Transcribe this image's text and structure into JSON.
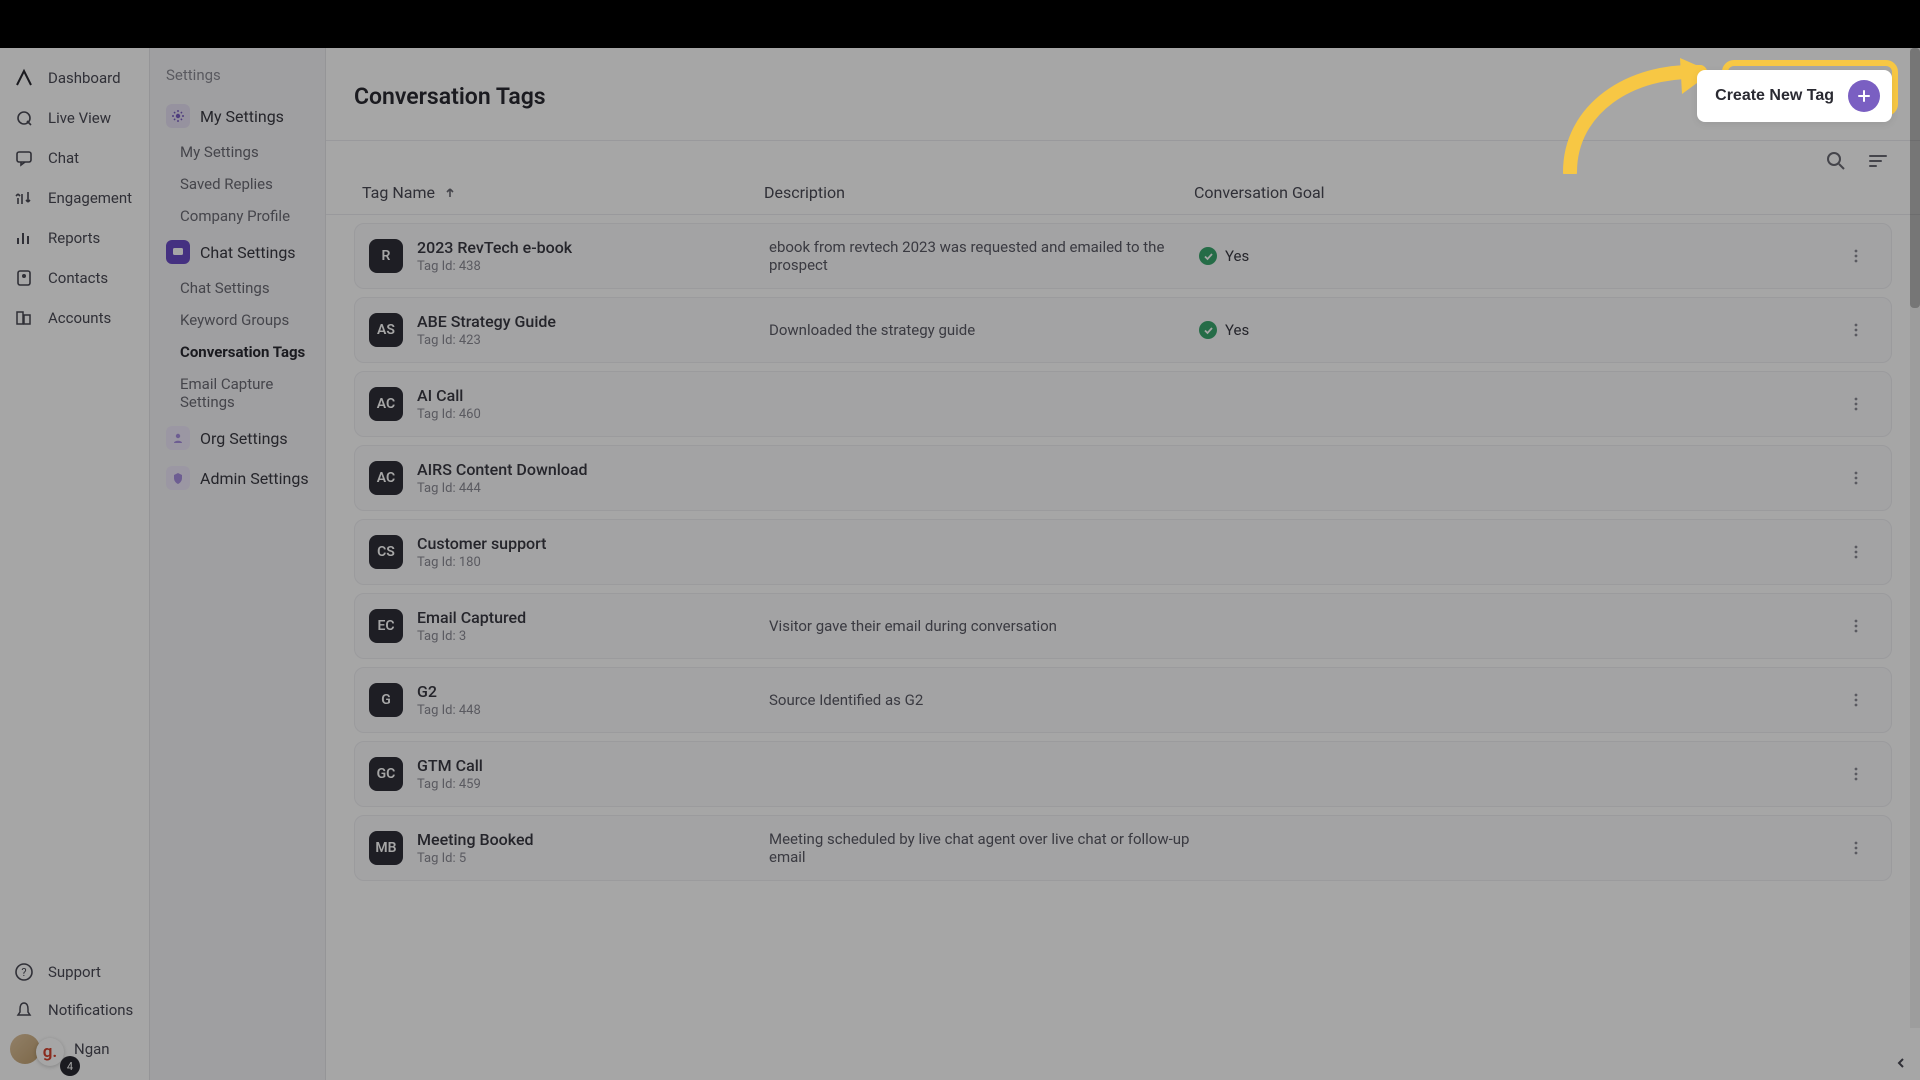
{
  "primaryNav": {
    "items": [
      {
        "label": "Dashboard"
      },
      {
        "label": "Live View"
      },
      {
        "label": "Chat"
      },
      {
        "label": "Engagement"
      },
      {
        "label": "Reports"
      },
      {
        "label": "Contacts"
      },
      {
        "label": "Accounts"
      }
    ],
    "bottom": [
      {
        "label": "Support"
      },
      {
        "label": "Notifications"
      }
    ],
    "user": {
      "name": "Ngan",
      "badge": "4",
      "g": "g."
    }
  },
  "settingsNav": {
    "title": "Settings",
    "sections": [
      {
        "label": "My Settings",
        "subs": [
          {
            "label": "My Settings"
          },
          {
            "label": "Saved Replies"
          },
          {
            "label": "Company Profile"
          }
        ]
      },
      {
        "label": "Chat Settings",
        "subs": [
          {
            "label": "Chat Settings"
          },
          {
            "label": "Keyword Groups"
          },
          {
            "label": "Conversation Tags",
            "active": true
          },
          {
            "label": "Email Capture Settings"
          }
        ]
      },
      {
        "label": "Org Settings"
      },
      {
        "label": "Admin Settings"
      }
    ]
  },
  "main": {
    "title": "Conversation Tags",
    "createLabel": "Create New Tag",
    "columns": {
      "name": "Tag Name",
      "desc": "Description",
      "conv": "Conversation Goal"
    },
    "tagIdPrefix": "Tag Id: "
  },
  "rows": [
    {
      "avatar": "R",
      "name": "2023 RevTech e-book",
      "id": "438",
      "desc": "ebook from revtech 2023 was requested and emailed to the prospect",
      "conv": "Yes"
    },
    {
      "avatar": "AS",
      "name": "ABE Strategy Guide",
      "id": "423",
      "desc": "Downloaded the strategy guide",
      "conv": "Yes"
    },
    {
      "avatar": "AC",
      "name": "AI Call",
      "id": "460",
      "desc": "",
      "conv": ""
    },
    {
      "avatar": "AC",
      "name": "AIRS Content Download",
      "id": "444",
      "desc": "",
      "conv": ""
    },
    {
      "avatar": "CS",
      "name": "Customer support",
      "id": "180",
      "desc": "",
      "conv": ""
    },
    {
      "avatar": "EC",
      "name": "Email Captured",
      "id": "3",
      "desc": "Visitor gave their email during conversation",
      "conv": ""
    },
    {
      "avatar": "G",
      "name": "G2",
      "id": "448",
      "desc": "Source Identified as G2",
      "conv": ""
    },
    {
      "avatar": "GC",
      "name": "GTM Call",
      "id": "459",
      "desc": "",
      "conv": ""
    },
    {
      "avatar": "MB",
      "name": "Meeting Booked",
      "id": "5",
      "desc": "Meeting scheduled by live chat agent over live chat or follow-up email",
      "conv": ""
    }
  ],
  "colors": {
    "accent": "#7a5fc2",
    "highlight": "#f7c744"
  }
}
